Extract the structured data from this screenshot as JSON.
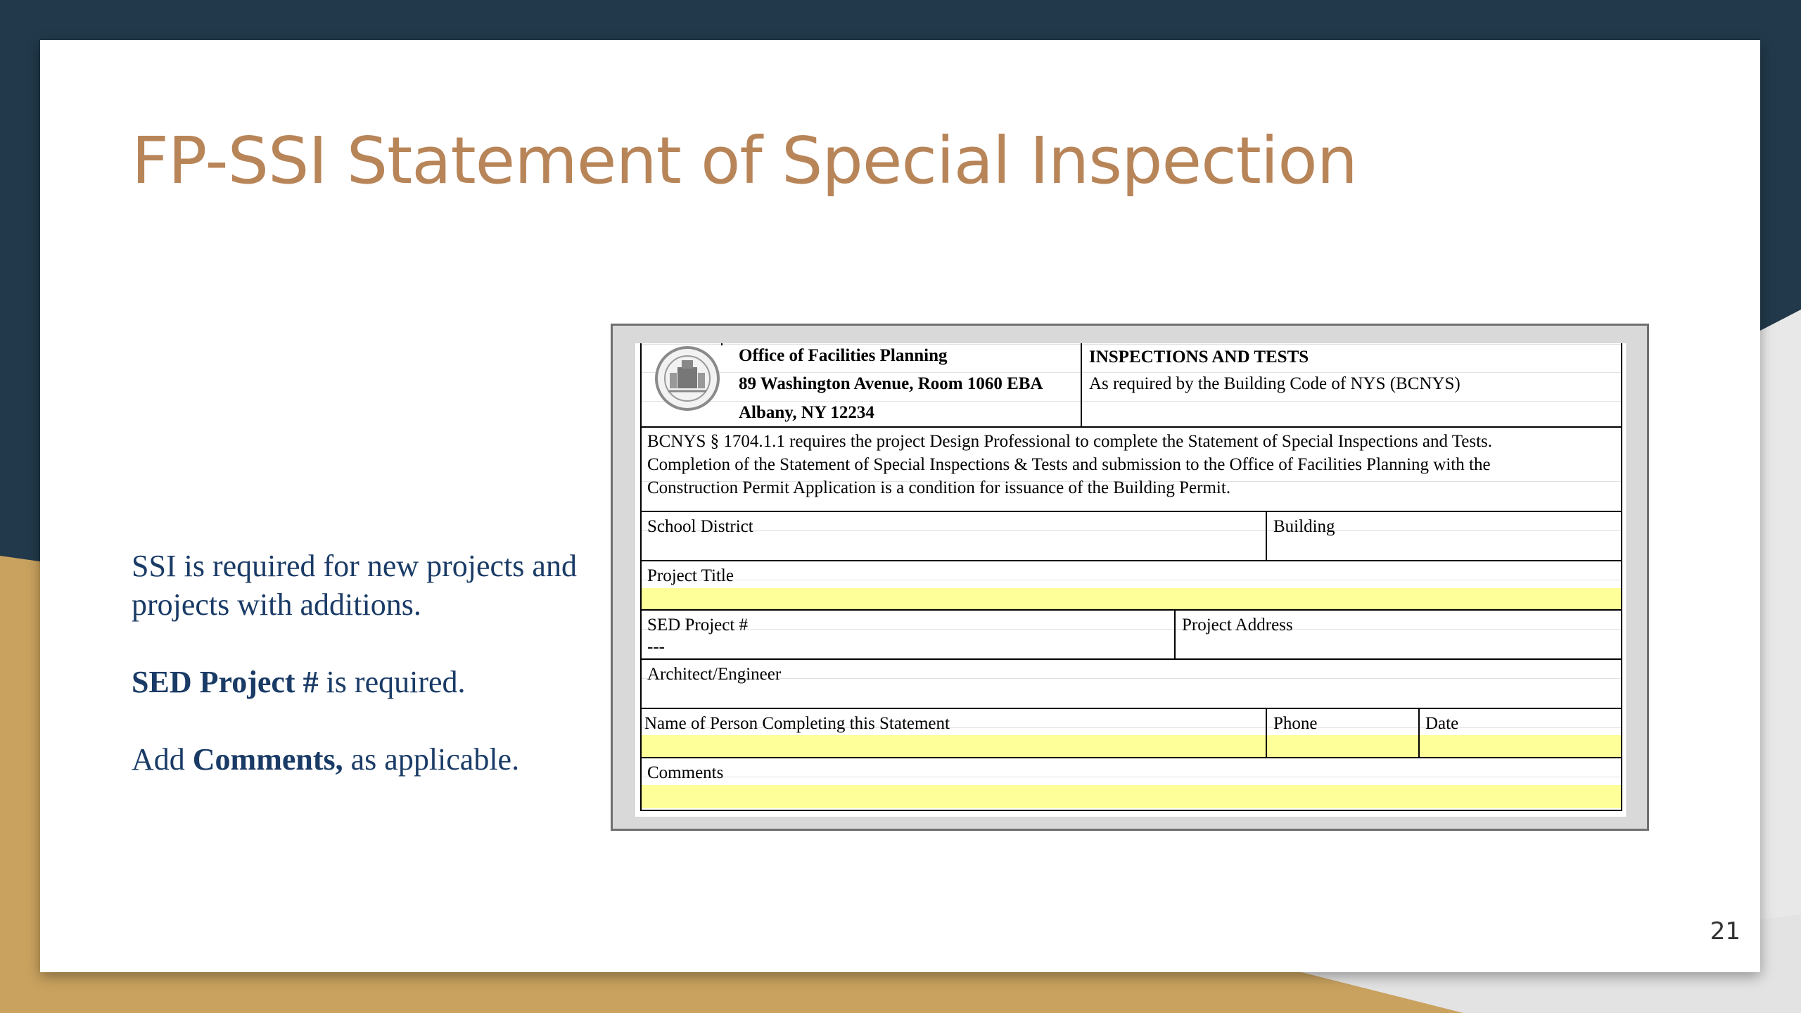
{
  "slide": {
    "title": "FP-SSI Statement of Special Inspection",
    "page_number": "21",
    "bullets": [
      {
        "plain": "SSI is required for new projects and projects with additions."
      },
      {
        "bold": "SED Project #",
        "rest": " is required."
      },
      {
        "plain_before": "Add ",
        "bold": "Comments,",
        "rest": " as applicable."
      }
    ]
  },
  "form": {
    "office": {
      "name": "Office of Facilities Planning",
      "address": "89 Washington Avenue, Room 1060 EBA",
      "city": "Albany, NY  12234"
    },
    "header": {
      "title": "INSPECTIONS AND TESTS",
      "subtitle": "As required by the Building Code of NYS (BCNYS)"
    },
    "notice": [
      "BCNYS § 1704.1.1 requires the project Design Professional to complete the Statement of Special Inspections and Tests.",
      "Completion of the Statement of Special Inspections & Tests and submission to the Office of Facilities Planning with the",
      "Construction Permit Application is a condition for issuance of the Building Permit."
    ],
    "fields": {
      "school_district": "School District",
      "building": "Building",
      "project_title": "Project Title",
      "sed_project": "SED Project #",
      "sed_project_value": "---",
      "project_address": "Project Address",
      "architect": "Architect/Engineer",
      "person": "Name of Person Completing this Statement",
      "phone": "Phone",
      "date": "Date",
      "comments": "Comments"
    },
    "highlight_color": "#ffff99"
  },
  "colors": {
    "title": "#b88559",
    "body_text": "#1a3b66",
    "background_dark": "#21394a",
    "background_gold": "#c9a25f"
  }
}
